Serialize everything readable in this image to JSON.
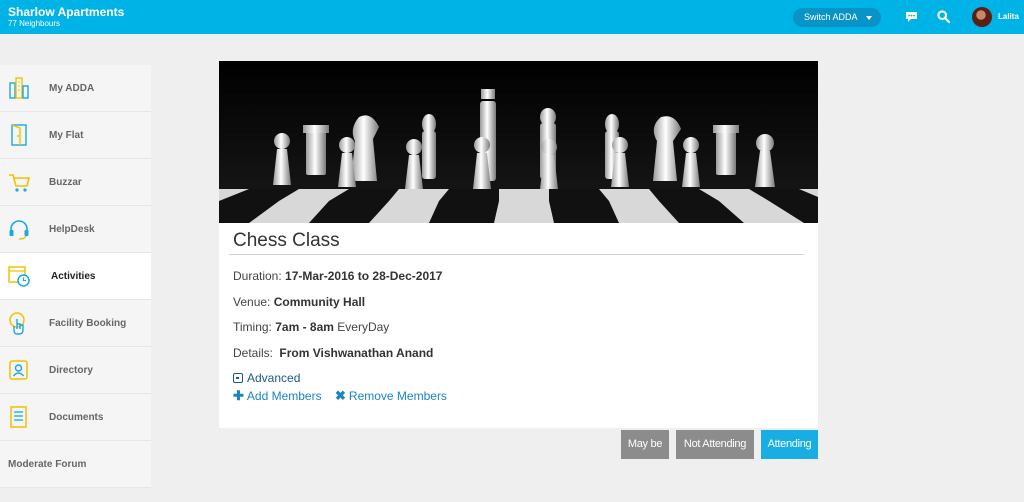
{
  "header": {
    "community": "Sharlow Apartments",
    "neighbours": "77 Neighbours",
    "switch_label": "Switch ADDA",
    "user_name": "Lalita",
    "icons": [
      "chat-icon",
      "search-icon",
      "avatar"
    ]
  },
  "sidebar": {
    "items": [
      {
        "label": "My ADDA",
        "icon": "building-icon"
      },
      {
        "label": "My Flat",
        "icon": "door-icon"
      },
      {
        "label": "Buzzar",
        "icon": "cart-icon"
      },
      {
        "label": "HelpDesk",
        "icon": "headset-icon"
      },
      {
        "label": "Activities",
        "icon": "calendar-clock-icon"
      },
      {
        "label": "Facility Booking",
        "icon": "hand-touch-icon"
      },
      {
        "label": "Directory",
        "icon": "contact-icon"
      },
      {
        "label": "Documents",
        "icon": "document-icon"
      },
      {
        "label": "Moderate Forum"
      }
    ],
    "active": "Activities"
  },
  "event": {
    "title": "Chess Class",
    "duration_label": "Duration:",
    "duration_value": "17-Mar-2016 to 28-Dec-2017",
    "venue_label": "Venue:",
    "venue_value": "Community Hall",
    "timing_label": "Timing:",
    "timing_value": "7am - 8am",
    "timing_suffix": "EveryDay",
    "details_label": "Details:",
    "details_value": "From Vishwanathan Anand",
    "advanced": "Advanced",
    "add_members": "Add Members",
    "remove_members": "Remove Members"
  },
  "rsvp": {
    "maybe": "May be",
    "not_attending": "Not Attending",
    "attending": "Attending"
  },
  "colors": {
    "topbar": "#00b3e6",
    "accent": "#18aee3",
    "icon_yellow": "#f2c200",
    "grey_button": "#8c8c8c"
  }
}
